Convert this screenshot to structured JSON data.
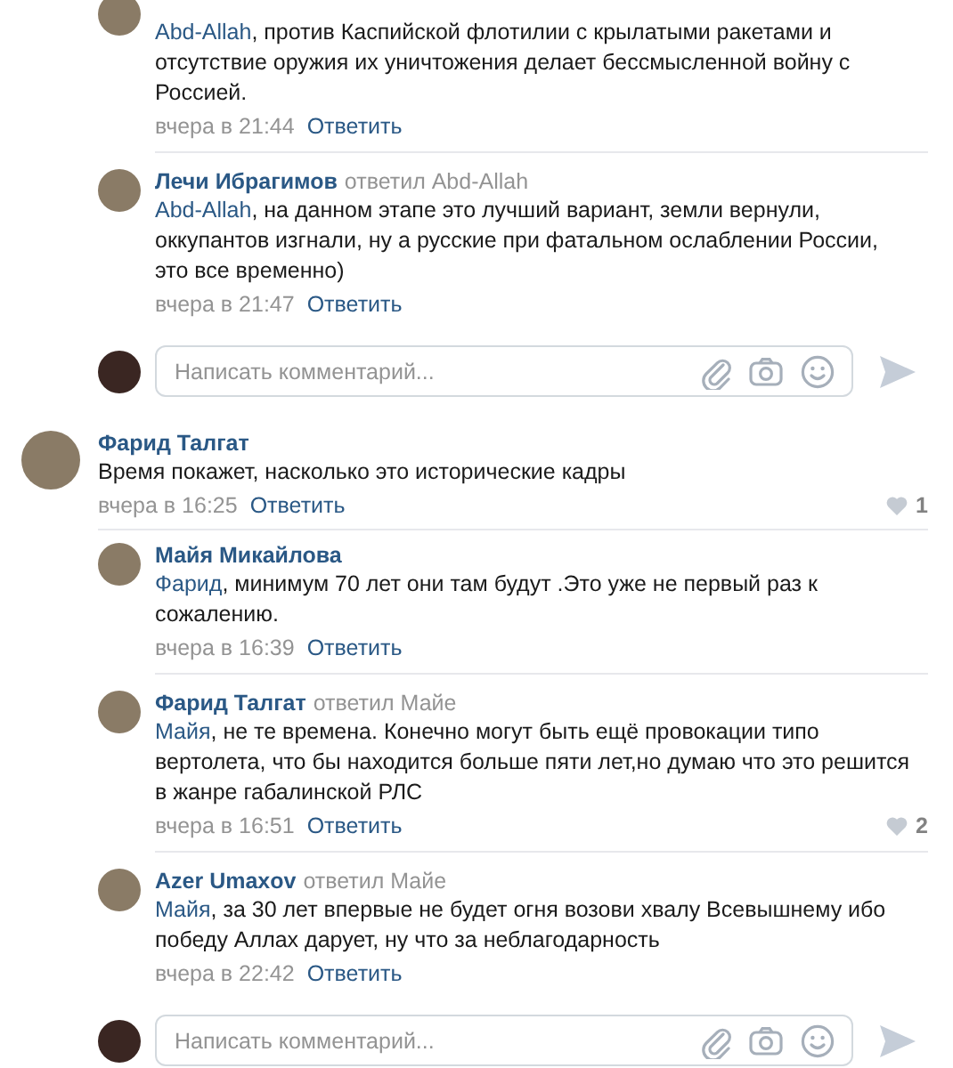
{
  "threads": [
    {
      "replies": [
        {
          "mention": "Abd-Allah",
          "text": ", против Каспийской флотилии с крылатыми ракетами и отсутствие оружия их уничтожения делает бессмысленной войну с Россией.",
          "time": "вчера в 21:44",
          "reply_link": "Ответить"
        },
        {
          "author": "Лечи Ибрагимов",
          "reply_to": "ответил Abd-Allah",
          "mention": "Abd-Allah",
          "text": ", на данном этапе это лучший вариант, земли вернули, оккупантов изгнали, ну а русские при фатальном ослаблении России, это все временно)",
          "time": "вчера в 21:47",
          "reply_link": "Ответить"
        }
      ],
      "input": {
        "placeholder": "Написать комментарий..."
      }
    },
    {
      "comment": {
        "author": "Фарид Талгат",
        "text": "Время покажет, насколько это исторические кадры",
        "time": "вчера в 16:25",
        "reply_link": "Ответить",
        "likes": "1"
      },
      "replies": [
        {
          "author": "Майя Микайлова",
          "mention": "Фарид",
          "text": ", минимум 70 лет они там будут .Это уже не первый раз к сожалению.",
          "time": "вчера в 16:39",
          "reply_link": "Ответить"
        },
        {
          "author": "Фарид Талгат",
          "reply_to": "ответил Майе",
          "mention": "Майя",
          "text": ", не те времена. Конечно могут быть ещё провокации типо вертолета, что бы находится больше пяти лет,но думаю что это решится в жанре габалинской РЛС",
          "time": "вчера в 16:51",
          "reply_link": "Ответить",
          "likes": "2"
        },
        {
          "author": "Azer Umaxov",
          "reply_to": "ответил Майе",
          "mention": "Майя",
          "text": ", за 30 лет впервые не будет огня возови хвалу Всевышнему ибо победу Аллах дарует, ну что за неблагодарность",
          "time": "вчера в 22:42",
          "reply_link": "Ответить"
        }
      ],
      "input": {
        "placeholder": "Написать комментарий..."
      }
    }
  ]
}
